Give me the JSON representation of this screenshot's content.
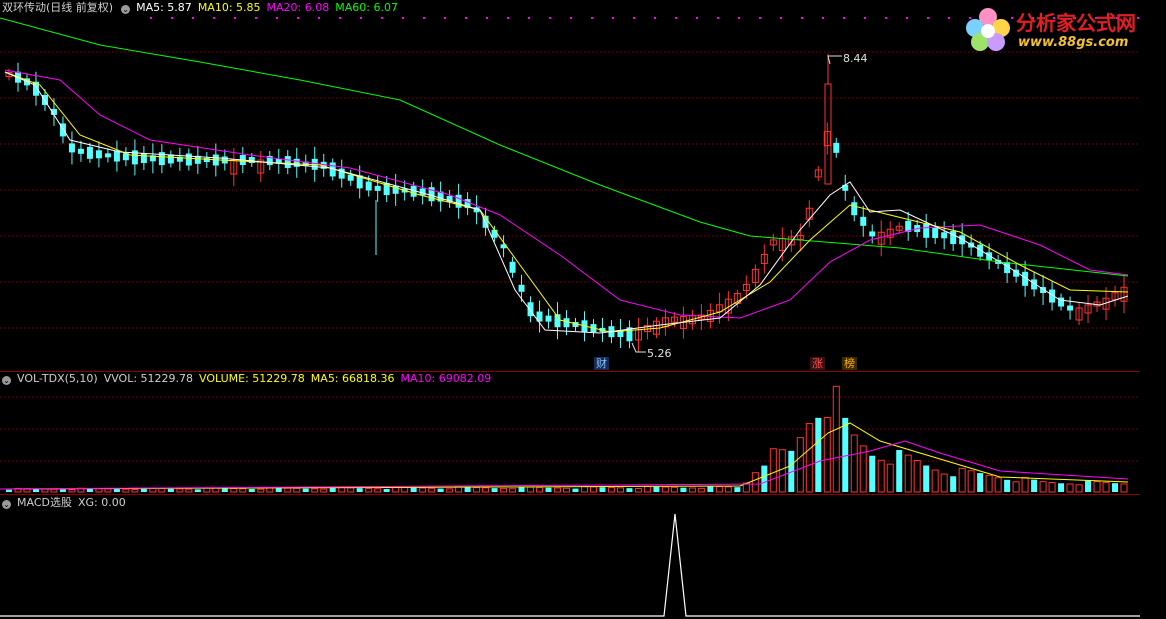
{
  "main": {
    "stock_name": "双环传动(日线 前复权)",
    "ma5_label": "MA5: 5.87",
    "ma10_label": "MA10: 5.85",
    "ma20_label": "MA20: 6.08",
    "ma60_label": "MA60: 6.07",
    "high_label": "8.44",
    "low_label": "5.26",
    "marker_cai": "财",
    "marker_zhang": "涨",
    "marker_bang": "榜"
  },
  "volume": {
    "indicator_label": "VOL-TDX(5,10)",
    "vvol_label": "VVOL: 51229.78",
    "volume_label": "VOLUME: 51229.78",
    "ma5_label": "MA5: 66818.36",
    "ma10_label": "MA10: 69082.09"
  },
  "macd": {
    "indicator_label": "MACD选股",
    "xg_label": "XG: 0.00"
  },
  "logo": {
    "title": "分析家公式网",
    "url": "www.88gs.com"
  },
  "colors": {
    "up": "#ff3232",
    "down": "#54ffff",
    "ma5": "#ffffff",
    "ma10": "#ffff00",
    "ma20": "#ff00ff",
    "ma60": "#00ff00",
    "grid": "#8b0000"
  },
  "icons": {
    "menu": "circle-chevron-icon"
  }
}
